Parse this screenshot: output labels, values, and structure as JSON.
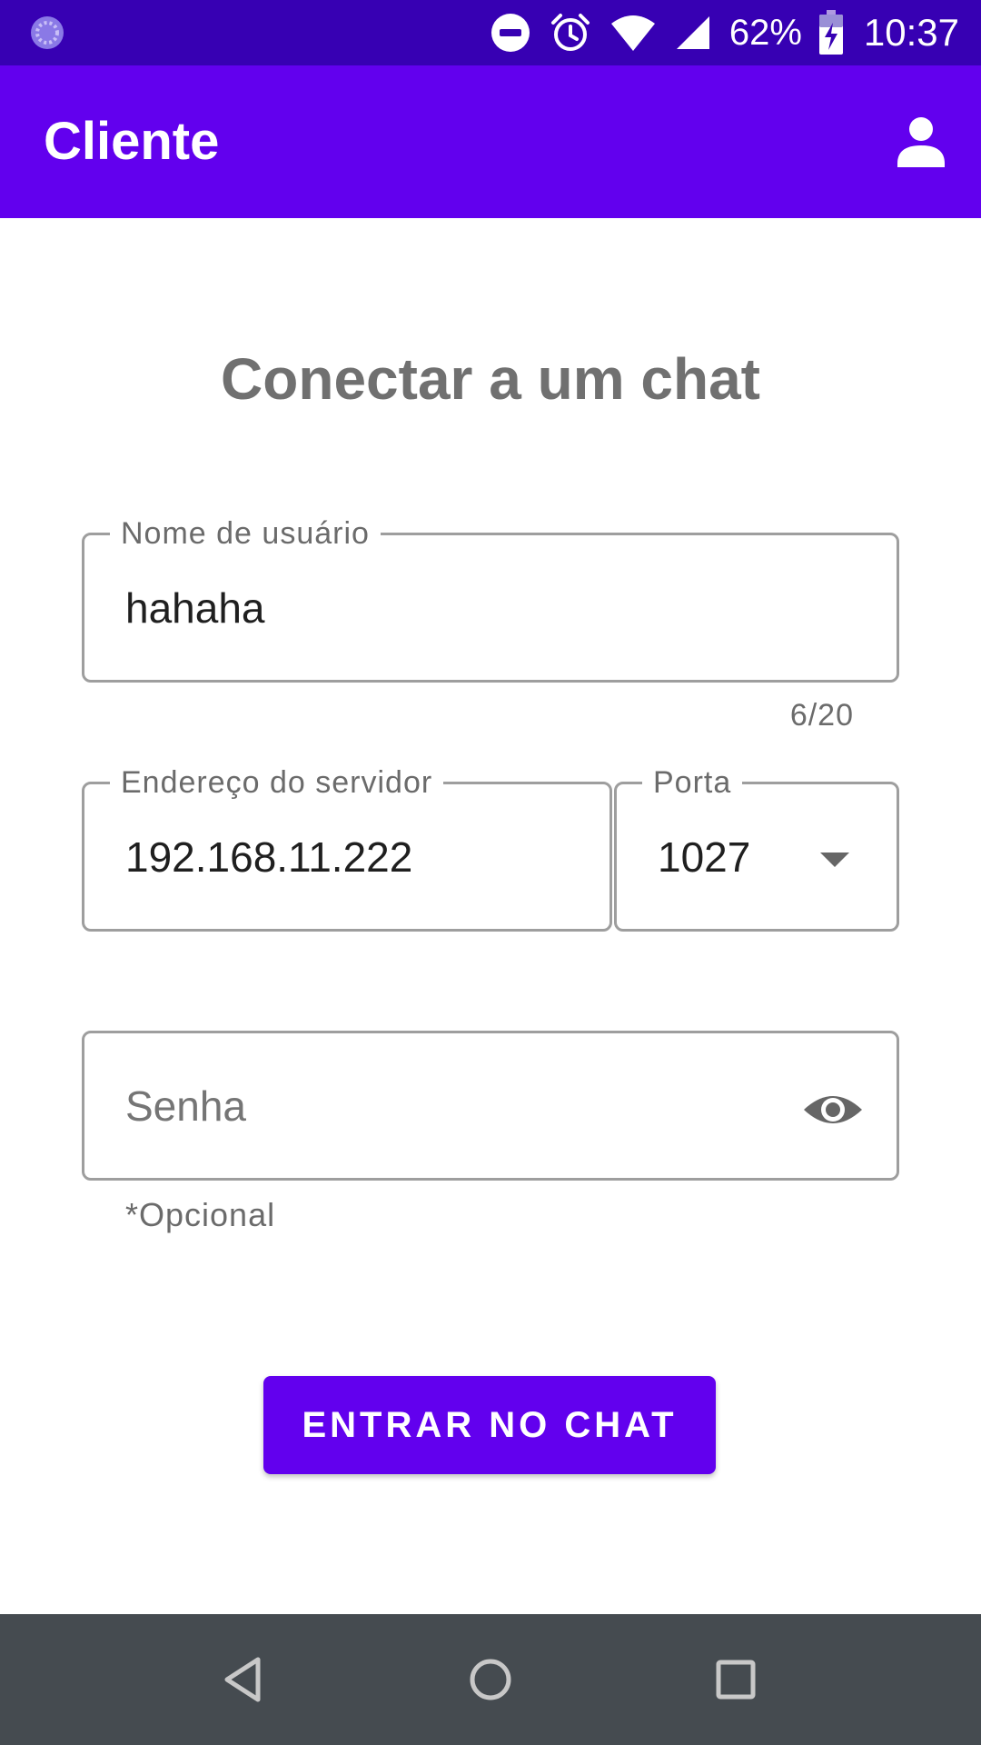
{
  "status_bar": {
    "notification_icon": "sync-icon",
    "icons": [
      "do-not-disturb-icon",
      "alarm-icon",
      "wifi-icon",
      "signal-icon"
    ],
    "battery_percent": "62%",
    "battery_icon": "battery-charging-icon",
    "time": "10:37"
  },
  "app_bar": {
    "title": "Cliente",
    "account_icon": "account-icon"
  },
  "form": {
    "title": "Conectar a um chat",
    "username": {
      "label": "Nome de usuário",
      "value": "hahaha",
      "counter": "6/20"
    },
    "server": {
      "label": "Endereço do servidor",
      "value": "192.168.11.222"
    },
    "port": {
      "label": "Porta",
      "value": "1027",
      "icon": "dropdown-arrow-icon"
    },
    "password": {
      "placeholder": "Senha",
      "helper": "*Opcional",
      "icon": "visibility-eye-icon"
    },
    "submit_label": "ENTRAR NO CHAT"
  },
  "nav_bar": {
    "buttons": [
      "back-icon",
      "home-icon",
      "recents-icon"
    ]
  },
  "colors": {
    "status_bar": "#3700B3",
    "primary": "#6200EE",
    "nav_bar": "#454b50",
    "outline": "#9e9e9e",
    "label": "#6b6b6b"
  }
}
